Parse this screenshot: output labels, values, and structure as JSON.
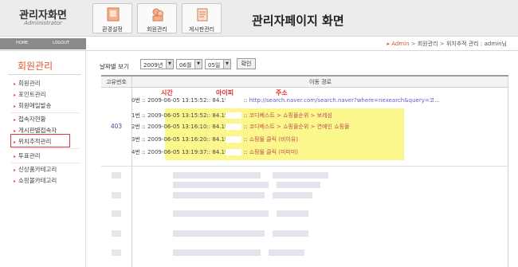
{
  "header": {
    "logo_title": "관리자화면",
    "logo_subtitle": "Administrator",
    "nav": [
      {
        "label": "환경설정",
        "icon": "settings-icon"
      },
      {
        "label": "회원관리",
        "icon": "members-icon"
      },
      {
        "label": "게시판관리",
        "icon": "board-icon"
      }
    ],
    "page_title": "관리자페이지 화면"
  },
  "subbar": {
    "home": "HOME",
    "logout": "LOGOUT",
    "breadcrumb": {
      "home": "▸ Admin",
      "sep1": " > ",
      "level1": "회원관리",
      "sep2": " > ",
      "level2": "위치추적 관리 : admin님"
    }
  },
  "sidebar": {
    "title": "회원관리",
    "items": [
      {
        "label": "회원관리"
      },
      {
        "label": "포인트관리"
      },
      {
        "label": "회원메일발송"
      },
      {
        "label": "접속자현황"
      },
      {
        "label": "게시판별접속자"
      },
      {
        "label": "위치추적관리"
      },
      {
        "label": "투표관리"
      },
      {
        "label": "신상품카테고리"
      },
      {
        "label": "쇼핑몰카테고리"
      }
    ],
    "selected_index": 5
  },
  "filter": {
    "label": "날짜별 보기",
    "year": "2009년",
    "month": "06월",
    "day": "05일",
    "confirm": "확인"
  },
  "table": {
    "col_id": "고유번호",
    "col_path": "이동 경로",
    "annotations": {
      "time": "시간",
      "ip": "아이피",
      "address": "주소"
    },
    "group_id": "403",
    "entries": [
      {
        "idx": "0번 :: ",
        "time": "2009-06-05 13:15:52",
        "ip": " :: 84.190.",
        "sep": " :: ",
        "addr": "http://search.naver.com/search.naver?where=nexearch&query=코...",
        "kind": "link"
      },
      {
        "idx": "1번 :: ",
        "time": "2009-06-05 13:15:52",
        "ip": " :: 84.190.",
        "sep": " :: ",
        "addr": "코디베스트 > 쇼핑몰순위 > 보레섬",
        "kind": "addr"
      },
      {
        "idx": "2번 :: ",
        "time": "2009-06-05 13:16:10",
        "ip": " :: 84.190.",
        "sep": " :: ",
        "addr": "코디베스트 > 쇼핑몰순위 > 연예인 쇼핑몰",
        "kind": "addr"
      },
      {
        "idx": "3번 :: ",
        "time": "2009-06-05 13:16:20",
        "ip": " :: 84.190.",
        "sep": " :: ",
        "addr": "쇼핑몰 클릭 (비이유)",
        "kind": "addr"
      },
      {
        "idx": "4번 :: ",
        "time": "2009-06-05 13:19:37",
        "ip": " :: 84.190.",
        "sep": " :: ",
        "addr": "쇼핑몰 클릭 (미미미)",
        "kind": "addr"
      }
    ]
  },
  "colors": {
    "accent": "#e2572b",
    "highlight": "#fbf78c",
    "annotation": "#e03030",
    "selection_box": "#e8323c"
  }
}
